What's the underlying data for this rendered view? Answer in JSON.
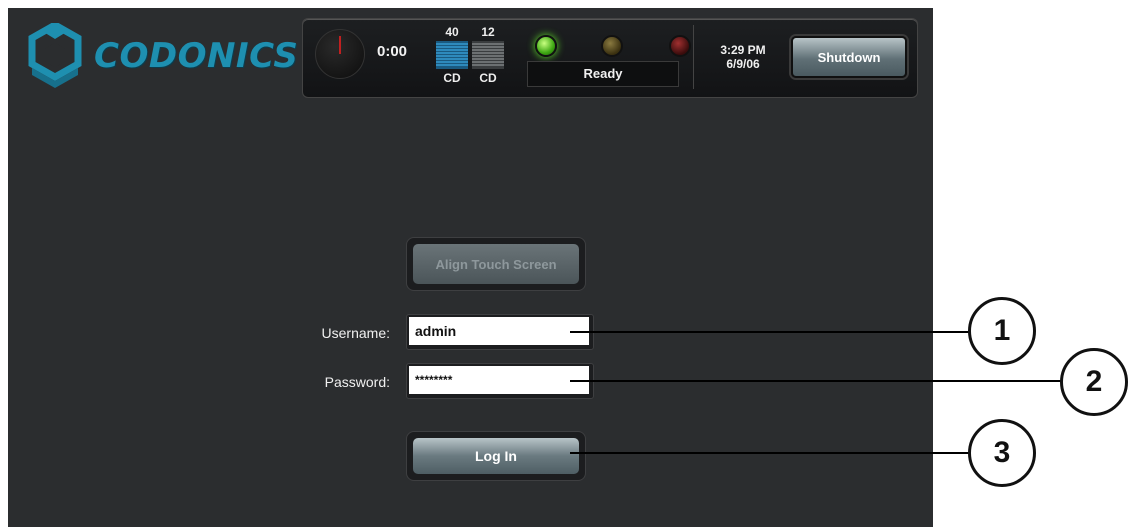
{
  "brand": {
    "name": "CODONICS",
    "color": "#1e8fb0"
  },
  "status_bar": {
    "timer": "0:00",
    "bins": [
      {
        "count": "40",
        "label": "CD",
        "color": "#2a8ec8"
      },
      {
        "count": "12",
        "label": "CD",
        "color": "#8a8e90"
      }
    ],
    "lights": [
      {
        "name": "green",
        "state": "on",
        "color": "#3ea813"
      },
      {
        "name": "yellow",
        "state": "off",
        "color": "#3a3010"
      },
      {
        "name": "red",
        "state": "off",
        "color": "#3a0c0c"
      }
    ],
    "status_text": "Ready",
    "time": "3:29 PM",
    "date": "6/9/06",
    "shutdown_label": "Shutdown"
  },
  "login": {
    "align_label": "Align Touch Screen",
    "username_label": "Username:",
    "username_value": "admin",
    "password_label": "Password:",
    "password_value": "********",
    "login_label": "Log In"
  },
  "callouts": [
    "1",
    "2",
    "3"
  ]
}
